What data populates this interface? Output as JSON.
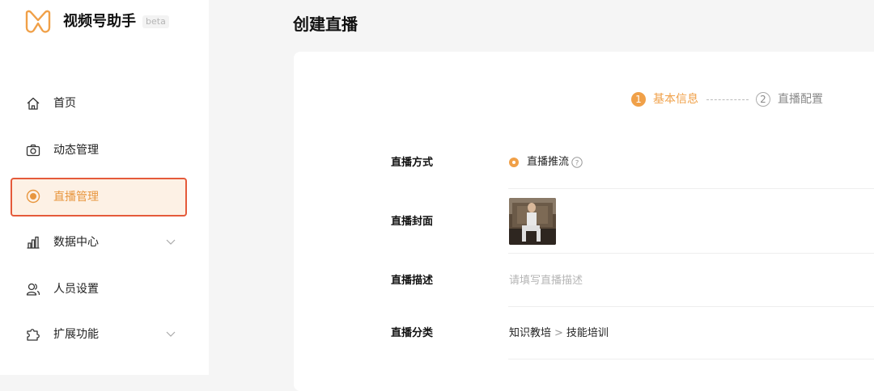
{
  "app": {
    "title": "视频号助手",
    "badge": "beta"
  },
  "colors": {
    "accent": "#f0a048",
    "highlight_border": "#e55a3a"
  },
  "sidebar": {
    "items": [
      {
        "label": "首页",
        "icon": "home-icon"
      },
      {
        "label": "动态管理",
        "icon": "camera-icon"
      },
      {
        "label": "直播管理",
        "icon": "live-icon",
        "active": true
      },
      {
        "label": "数据中心",
        "icon": "chart-icon",
        "expandable": true
      },
      {
        "label": "人员设置",
        "icon": "users-icon"
      },
      {
        "label": "扩展功能",
        "icon": "puzzle-icon",
        "expandable": true
      }
    ]
  },
  "main": {
    "title": "创建直播",
    "steps": [
      {
        "num": "1",
        "label": "基本信息",
        "active": true
      },
      {
        "num": "2",
        "label": "直播配置",
        "active": false
      }
    ],
    "form": {
      "mode_label": "直播方式",
      "mode_value": "直播推流",
      "cover_label": "直播封面",
      "desc_label": "直播描述",
      "desc_placeholder": "请填写直播描述",
      "category_label": "直播分类",
      "category_parent": "知识教培",
      "category_separator": ">",
      "category_child": "技能培训"
    }
  }
}
